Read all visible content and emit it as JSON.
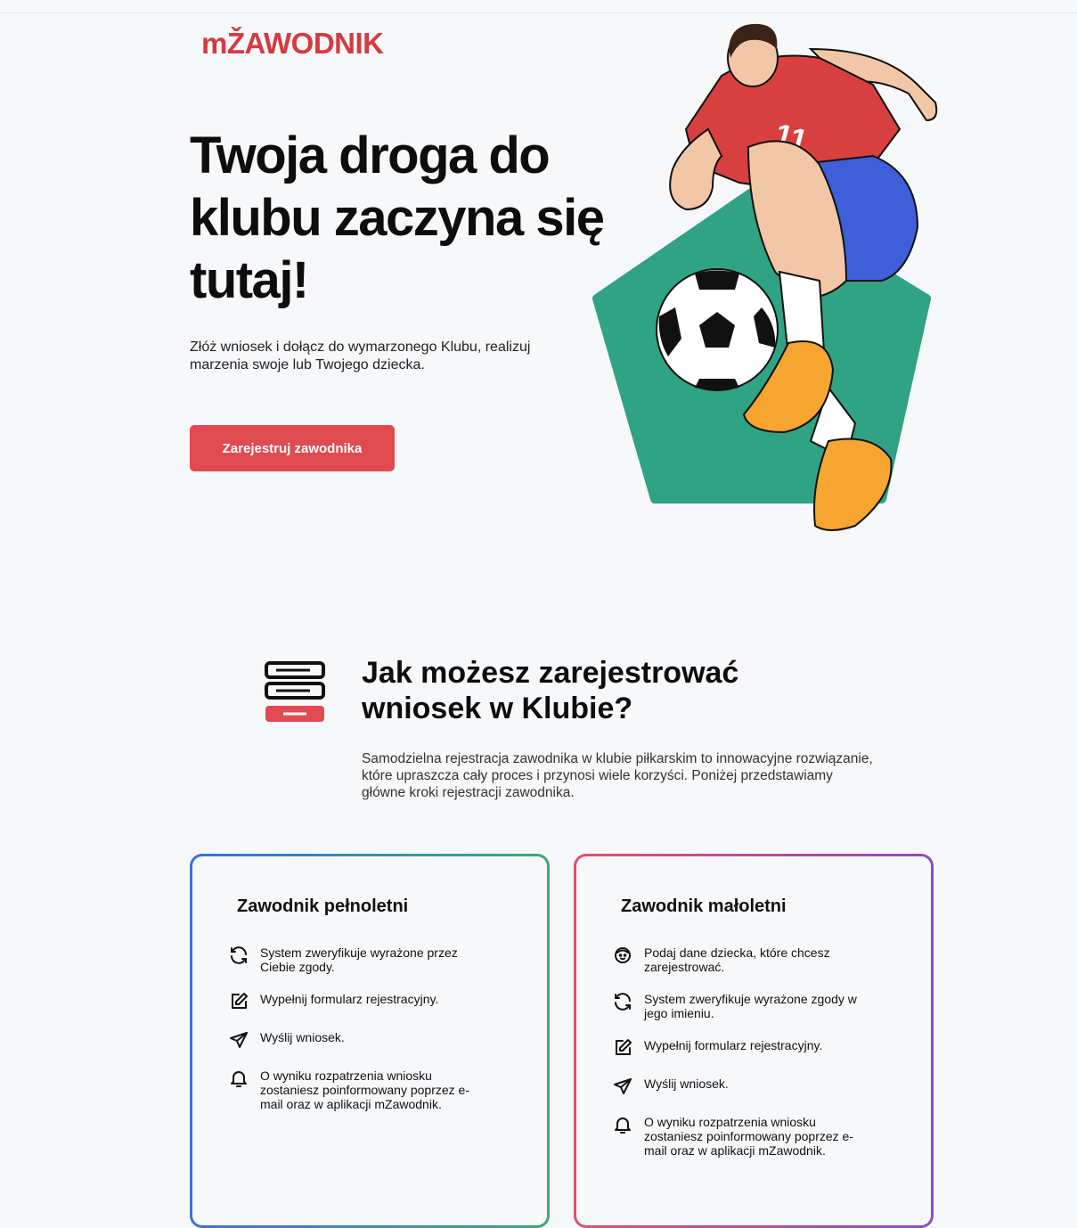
{
  "brand": {
    "logo": "mŽAWODNIK",
    "accent": "#d63a41"
  },
  "hero": {
    "title": "Twoja droga do klubu zaczyna się tutaj!",
    "subtitle": "Złóż wniosek i dołącz do wymarzonego Klubu, realizuj marzenia swoje lub Twojego dziecka.",
    "cta_label": "Zarejestruj zawodnika",
    "illustration_icon": "soccer-player-illustration",
    "player_number": "11"
  },
  "section": {
    "icon": "registration-form-icon",
    "title": "Jak możesz zarejestrować wniosek w Klubie?",
    "description": "Samodzielna rejestracja zawodnika w klubie piłkarskim to innowacyjne rozwiązanie, które upraszcza cały proces i przynosi wiele korzyści. Poniżej przedstawiamy główne kroki rejestracji zawodnika."
  },
  "cards": [
    {
      "title": "Zawodnik pełnoletni",
      "steps": [
        {
          "icon": "refresh-icon",
          "text": "System zweryfikuje wyrażone przez Ciebie zgody."
        },
        {
          "icon": "edit-icon",
          "text": "Wypełnij formularz rejestracyjny."
        },
        {
          "icon": "send-icon",
          "text": "Wyślij wniosek."
        },
        {
          "icon": "bell-icon",
          "text": "O wyniku rozpatrzenia wniosku zostaniesz poinformowany poprzez e-mail oraz w aplikacji mZawodnik."
        }
      ]
    },
    {
      "title": "Zawodnik małoletni",
      "steps": [
        {
          "icon": "child-face-icon",
          "text": "Podaj dane dziecka, które chcesz zarejestrować."
        },
        {
          "icon": "refresh-icon",
          "text": "System zweryfikuje wyrażone zgody w jego imieniu."
        },
        {
          "icon": "edit-icon",
          "text": "Wypełnij formularz rejestracyjny."
        },
        {
          "icon": "send-icon",
          "text": "Wyślij wniosek."
        },
        {
          "icon": "bell-icon",
          "text": "O wyniku rozpatrzenia wniosku zostaniesz poinformowany poprzez e-mail oraz w aplikacji mZawodnik."
        }
      ]
    }
  ]
}
